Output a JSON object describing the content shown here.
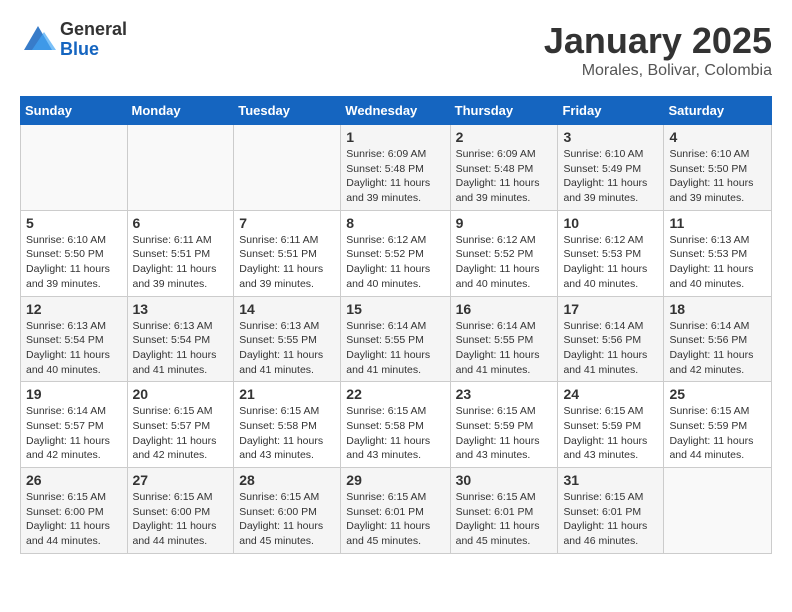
{
  "logo": {
    "general": "General",
    "blue": "Blue"
  },
  "title": "January 2025",
  "location": "Morales, Bolivar, Colombia",
  "weekdays": [
    "Sunday",
    "Monday",
    "Tuesday",
    "Wednesday",
    "Thursday",
    "Friday",
    "Saturday"
  ],
  "weeks": [
    [
      {
        "day": "",
        "info": ""
      },
      {
        "day": "",
        "info": ""
      },
      {
        "day": "",
        "info": ""
      },
      {
        "day": "1",
        "info": "Sunrise: 6:09 AM\nSunset: 5:48 PM\nDaylight: 11 hours and 39 minutes."
      },
      {
        "day": "2",
        "info": "Sunrise: 6:09 AM\nSunset: 5:48 PM\nDaylight: 11 hours and 39 minutes."
      },
      {
        "day": "3",
        "info": "Sunrise: 6:10 AM\nSunset: 5:49 PM\nDaylight: 11 hours and 39 minutes."
      },
      {
        "day": "4",
        "info": "Sunrise: 6:10 AM\nSunset: 5:50 PM\nDaylight: 11 hours and 39 minutes."
      }
    ],
    [
      {
        "day": "5",
        "info": "Sunrise: 6:10 AM\nSunset: 5:50 PM\nDaylight: 11 hours and 39 minutes."
      },
      {
        "day": "6",
        "info": "Sunrise: 6:11 AM\nSunset: 5:51 PM\nDaylight: 11 hours and 39 minutes."
      },
      {
        "day": "7",
        "info": "Sunrise: 6:11 AM\nSunset: 5:51 PM\nDaylight: 11 hours and 39 minutes."
      },
      {
        "day": "8",
        "info": "Sunrise: 6:12 AM\nSunset: 5:52 PM\nDaylight: 11 hours and 40 minutes."
      },
      {
        "day": "9",
        "info": "Sunrise: 6:12 AM\nSunset: 5:52 PM\nDaylight: 11 hours and 40 minutes."
      },
      {
        "day": "10",
        "info": "Sunrise: 6:12 AM\nSunset: 5:53 PM\nDaylight: 11 hours and 40 minutes."
      },
      {
        "day": "11",
        "info": "Sunrise: 6:13 AM\nSunset: 5:53 PM\nDaylight: 11 hours and 40 minutes."
      }
    ],
    [
      {
        "day": "12",
        "info": "Sunrise: 6:13 AM\nSunset: 5:54 PM\nDaylight: 11 hours and 40 minutes."
      },
      {
        "day": "13",
        "info": "Sunrise: 6:13 AM\nSunset: 5:54 PM\nDaylight: 11 hours and 41 minutes."
      },
      {
        "day": "14",
        "info": "Sunrise: 6:13 AM\nSunset: 5:55 PM\nDaylight: 11 hours and 41 minutes."
      },
      {
        "day": "15",
        "info": "Sunrise: 6:14 AM\nSunset: 5:55 PM\nDaylight: 11 hours and 41 minutes."
      },
      {
        "day": "16",
        "info": "Sunrise: 6:14 AM\nSunset: 5:55 PM\nDaylight: 11 hours and 41 minutes."
      },
      {
        "day": "17",
        "info": "Sunrise: 6:14 AM\nSunset: 5:56 PM\nDaylight: 11 hours and 41 minutes."
      },
      {
        "day": "18",
        "info": "Sunrise: 6:14 AM\nSunset: 5:56 PM\nDaylight: 11 hours and 42 minutes."
      }
    ],
    [
      {
        "day": "19",
        "info": "Sunrise: 6:14 AM\nSunset: 5:57 PM\nDaylight: 11 hours and 42 minutes."
      },
      {
        "day": "20",
        "info": "Sunrise: 6:15 AM\nSunset: 5:57 PM\nDaylight: 11 hours and 42 minutes."
      },
      {
        "day": "21",
        "info": "Sunrise: 6:15 AM\nSunset: 5:58 PM\nDaylight: 11 hours and 43 minutes."
      },
      {
        "day": "22",
        "info": "Sunrise: 6:15 AM\nSunset: 5:58 PM\nDaylight: 11 hours and 43 minutes."
      },
      {
        "day": "23",
        "info": "Sunrise: 6:15 AM\nSunset: 5:59 PM\nDaylight: 11 hours and 43 minutes."
      },
      {
        "day": "24",
        "info": "Sunrise: 6:15 AM\nSunset: 5:59 PM\nDaylight: 11 hours and 43 minutes."
      },
      {
        "day": "25",
        "info": "Sunrise: 6:15 AM\nSunset: 5:59 PM\nDaylight: 11 hours and 44 minutes."
      }
    ],
    [
      {
        "day": "26",
        "info": "Sunrise: 6:15 AM\nSunset: 6:00 PM\nDaylight: 11 hours and 44 minutes."
      },
      {
        "day": "27",
        "info": "Sunrise: 6:15 AM\nSunset: 6:00 PM\nDaylight: 11 hours and 44 minutes."
      },
      {
        "day": "28",
        "info": "Sunrise: 6:15 AM\nSunset: 6:00 PM\nDaylight: 11 hours and 45 minutes."
      },
      {
        "day": "29",
        "info": "Sunrise: 6:15 AM\nSunset: 6:01 PM\nDaylight: 11 hours and 45 minutes."
      },
      {
        "day": "30",
        "info": "Sunrise: 6:15 AM\nSunset: 6:01 PM\nDaylight: 11 hours and 45 minutes."
      },
      {
        "day": "31",
        "info": "Sunrise: 6:15 AM\nSunset: 6:01 PM\nDaylight: 11 hours and 46 minutes."
      },
      {
        "day": "",
        "info": ""
      }
    ]
  ]
}
